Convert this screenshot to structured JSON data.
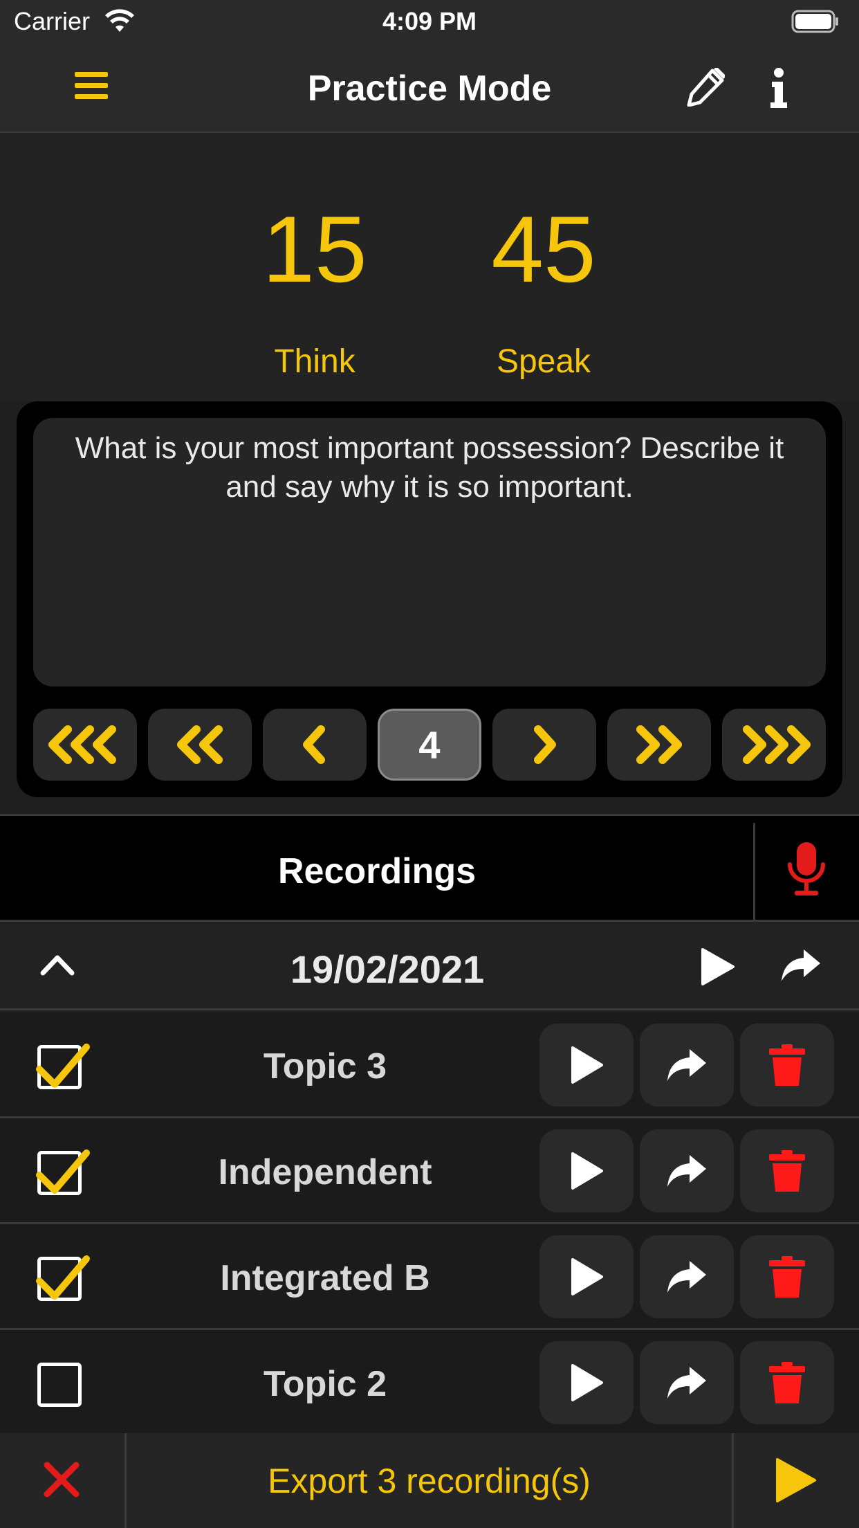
{
  "status_bar": {
    "carrier": "Carrier",
    "time": "4:09 PM"
  },
  "nav": {
    "title": "Practice Mode",
    "icons": [
      "menu-icon",
      "pencil-icon",
      "info-icon"
    ]
  },
  "timers": {
    "think": {
      "value": "15",
      "label": "Think"
    },
    "speak": {
      "value": "45",
      "label": "Speak"
    }
  },
  "prompt": {
    "text": "What is your most important possession? Describe it and say why it is so important."
  },
  "pager": {
    "current_page": "4",
    "buttons": [
      "first",
      "back-10",
      "prev",
      "page",
      "next",
      "forward-10",
      "last"
    ]
  },
  "recordings": {
    "title": "Recordings",
    "date": "19/02/2021"
  },
  "rows": [
    {
      "title": "Topic 3",
      "checked": true
    },
    {
      "title": "Independent",
      "checked": true
    },
    {
      "title": "Integrated B",
      "checked": true
    },
    {
      "title": "Topic 2",
      "checked": false
    }
  ],
  "bottom": {
    "export_label": "Export 3 recording(s)"
  },
  "colors": {
    "accent": "#f5c60c",
    "delete": "#ff1a1a",
    "record": "#e31b1b",
    "background": "#1f1f1f"
  }
}
